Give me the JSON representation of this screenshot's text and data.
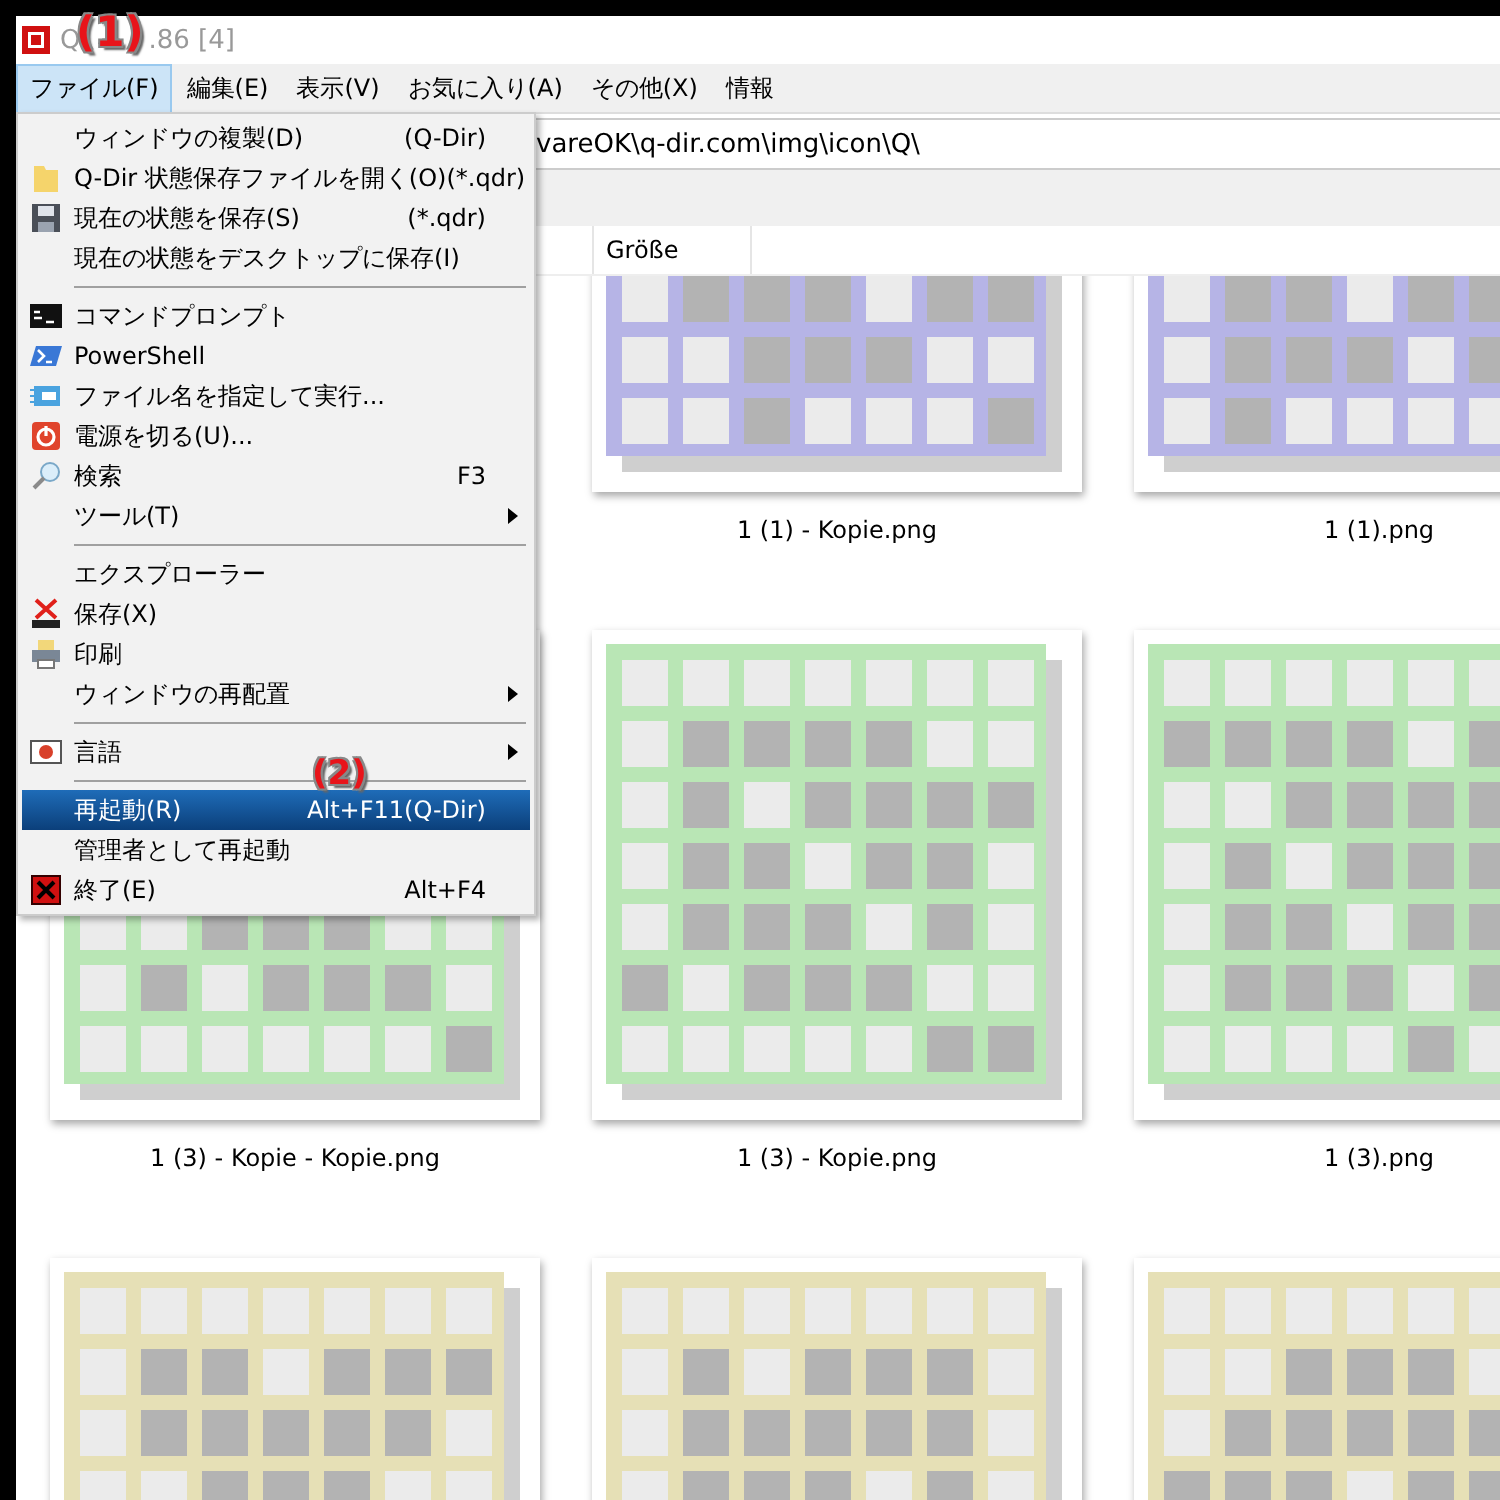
{
  "window": {
    "title_start": "Q",
    "title_end": ".86 [4]"
  },
  "annotations": [
    {
      "label": "(1)"
    },
    {
      "label": "(2)"
    }
  ],
  "menu_bar": [
    {
      "label": "ファイル(F)",
      "selected": true
    },
    {
      "label": "編集(E)",
      "selected": false
    },
    {
      "label": "表示(V)",
      "selected": false
    },
    {
      "label": "お気に入り(A)",
      "selected": false
    },
    {
      "label": "その他(X)",
      "selected": false
    },
    {
      "label": "情報",
      "selected": false
    }
  ],
  "address_bar": {
    "value": "vareOK\\q-dir.com\\img\\icon\\Q\\"
  },
  "columns": [
    "Größe"
  ],
  "menu": [
    {
      "kind": "item",
      "label": "ウィンドウの複製(D)",
      "shortcut": "(Q-Dir)",
      "submenu": false,
      "selected": false
    },
    {
      "kind": "item",
      "label": "Q-Dir 状態保存ファイルを開く(O)",
      "shortcut": "(*.qdr)",
      "submenu": false,
      "selected": false
    },
    {
      "kind": "item",
      "label": "現在の状態を保存(S)",
      "shortcut": "(*.qdr)",
      "submenu": false,
      "selected": false
    },
    {
      "kind": "item",
      "label": "現在の状態をデスクトップに保存(I)",
      "submenu": false,
      "selected": false
    },
    {
      "kind": "separator"
    },
    {
      "kind": "item",
      "label": "コマンドプロンプト",
      "submenu": false,
      "selected": false
    },
    {
      "kind": "item",
      "label": "PowerShell",
      "submenu": false,
      "selected": false
    },
    {
      "kind": "item",
      "label": "ファイル名を指定して実行...",
      "submenu": false,
      "selected": false
    },
    {
      "kind": "item",
      "label": "電源を切る(U)...",
      "submenu": false,
      "selected": false
    },
    {
      "kind": "item",
      "label": "検索",
      "shortcut": "F3",
      "submenu": false,
      "selected": false
    },
    {
      "kind": "item",
      "label": "ツール(T)",
      "submenu": true,
      "selected": false
    },
    {
      "kind": "separator"
    },
    {
      "kind": "item",
      "label": "エクスプローラー",
      "submenu": false,
      "selected": false
    },
    {
      "kind": "item",
      "label": "保存(X)",
      "submenu": false,
      "selected": false
    },
    {
      "kind": "item",
      "label": "印刷",
      "submenu": false,
      "selected": false
    },
    {
      "kind": "item",
      "label": "ウィンドウの再配置",
      "submenu": true,
      "selected": false
    },
    {
      "kind": "separator"
    },
    {
      "kind": "item",
      "label": "言語",
      "submenu": true,
      "selected": false
    },
    {
      "kind": "separator"
    },
    {
      "kind": "item",
      "label": "再起動(R)",
      "shortcut": "Alt+F11(Q-Dir)",
      "submenu": false,
      "selected": true
    },
    {
      "kind": "item",
      "label": "管理者として再起動",
      "submenu": false,
      "selected": false
    },
    {
      "kind": "item",
      "label": "終了(E)",
      "shortcut": "Alt+F4",
      "submenu": false,
      "selected": false
    }
  ],
  "file_rows": [
    {
      "items": [
        {
          "name": "1 (1) - Kopie.png",
          "color": "#b6b4e6"
        },
        {
          "name": "1 (1).png",
          "color": "#b6b4e6"
        }
      ]
    },
    {
      "items": [
        {
          "name": "1 (3) - Kopie - Kopie.png",
          "color": "#b9e6b5"
        },
        {
          "name": "1 (3) - Kopie.png",
          "color": "#b9e6b5"
        },
        {
          "name": "1 (3).png",
          "color": "#b9e6b5"
        }
      ]
    },
    {
      "items": [
        {
          "color": "#e6e0b6"
        },
        {
          "color": "#e6e0b6"
        },
        {
          "color": "#e6e0b6"
        }
      ]
    }
  ]
}
